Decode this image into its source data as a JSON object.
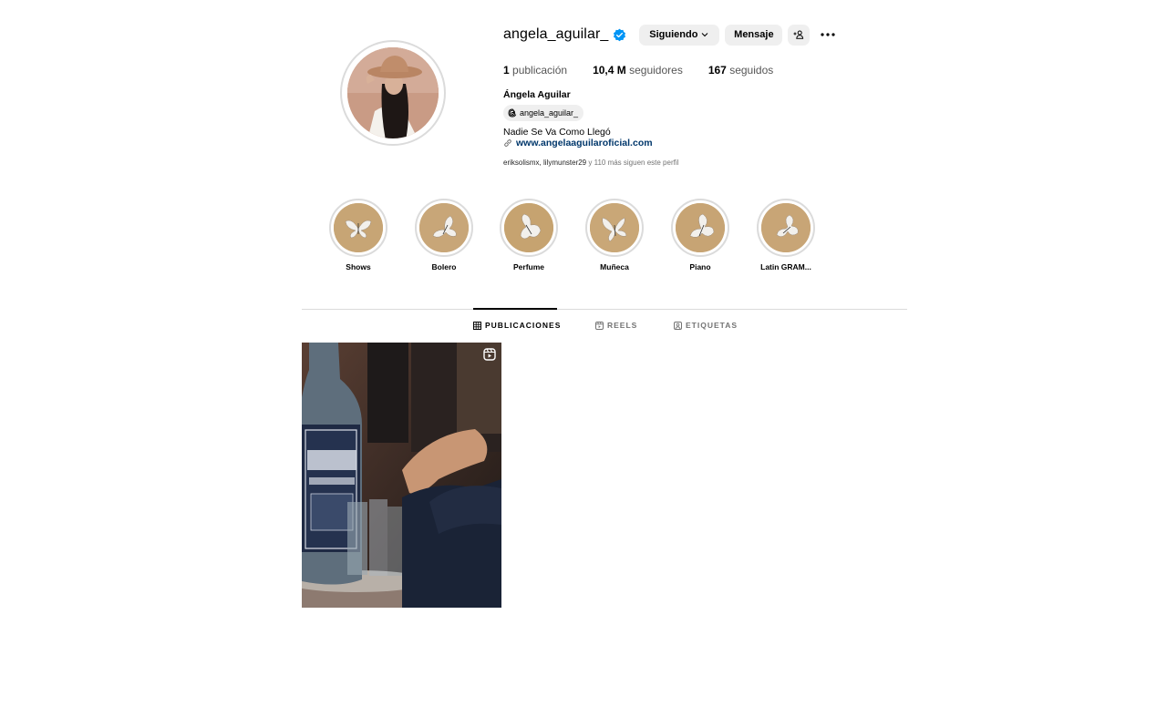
{
  "profile": {
    "username": "angela_aguilar_",
    "full_name": "Ángela Aguilar",
    "threads_handle": "angela_aguilar_",
    "bio": "Nadie Se Va Como Llegó",
    "website": "www.angelaaguilaroficial.com",
    "followed_by_names": "eriksolismx, lilymunster29",
    "followed_by_rest": " y 110 más siguen este perfil",
    "verified": true
  },
  "actions": {
    "following_label": "Siguiendo",
    "message_label": "Mensaje"
  },
  "stats": {
    "posts_count": "1",
    "posts_label": "publicación",
    "followers_count": "10,4 M",
    "followers_label": "seguidores",
    "following_count": "167",
    "following_label": "seguidos"
  },
  "highlights": [
    {
      "label": "Shows"
    },
    {
      "label": "Bolero"
    },
    {
      "label": "Perfume"
    },
    {
      "label": "Muñeca"
    },
    {
      "label": "Piano"
    },
    {
      "label": "Latin GRAM..."
    }
  ],
  "tabs": [
    {
      "label": "PUBLICACIONES",
      "active": true,
      "icon": "grid-icon"
    },
    {
      "label": "REELS",
      "active": false,
      "icon": "reels-icon"
    },
    {
      "label": "ETIQUETAS",
      "active": false,
      "icon": "tagged-icon"
    }
  ],
  "colors": {
    "verified_blue": "#0095f6",
    "link_blue": "#00376b",
    "button_gray": "#efefef",
    "divider": "#dbdbdb"
  }
}
